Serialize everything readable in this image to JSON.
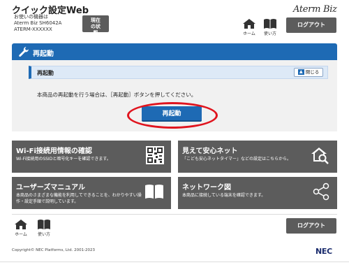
{
  "header": {
    "title": "クイック設定Web",
    "device_caption": "お使いの機器は",
    "device_model": "Aterm Biz SH6042A",
    "device_id": "ATERM-XXXXXX",
    "status_button": "現在の状態",
    "brand": "Aterm Biz",
    "home_label": "ホーム",
    "manual_label": "使い方",
    "logout_label": "ログアウト"
  },
  "section": {
    "title": "再起動",
    "sub_title": "再起動",
    "collapse_label": "閉じる",
    "message": "本商品の再起動を行う場合は、［再起動］ボタンを押してください。",
    "restart_button": "再起動"
  },
  "tiles": [
    {
      "title": "Wi-Fi接続用情報の確認",
      "desc": "Wi-Fi接続用のSSIDと暗号化キーを確認できます。",
      "icon": "qr-code-icon"
    },
    {
      "title": "見えて安心ネット",
      "desc": "「こども安心ネットタイマー」などの設定はこちらから。",
      "icon": "home-search-icon"
    },
    {
      "title": "ユーザーズマニュアル",
      "desc": "本商品のさまざまな機能を利用してできることを、わかりやすい操作・設定手順で説明しています。",
      "icon": "book-icon"
    },
    {
      "title": "ネットワーク図",
      "desc": "本商品に接続している端末を確認できます。",
      "icon": "share-network-icon"
    }
  ],
  "footer": {
    "home_label": "ホーム",
    "manual_label": "使い方",
    "logout_label": "ログアウト",
    "copyright": "Copyright© NEC Platforms, Ltd. 2001-2023",
    "nec_logo": "NEC"
  },
  "colors": {
    "primary_blue": "#1e6ab4",
    "tile_gray": "#5c5c5c",
    "highlight_red": "#e0141e"
  }
}
